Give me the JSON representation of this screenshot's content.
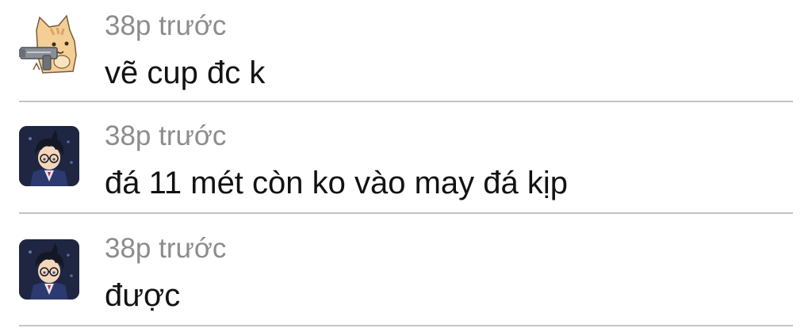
{
  "comments": [
    {
      "avatar_icon": "cat-with-gun-avatar",
      "time": "38p trước",
      "text": "vẽ cup đc k"
    },
    {
      "avatar_icon": "anime-boy-avatar",
      "time": "38p trước",
      "text": "đá 11 mét còn ko vào may đá kịp"
    },
    {
      "avatar_icon": "anime-boy-avatar",
      "time": "38p trước",
      "text": "được"
    }
  ],
  "colors": {
    "time_text": "#8c8c8c",
    "body_text": "#121212",
    "divider": "#c4c4c4"
  }
}
